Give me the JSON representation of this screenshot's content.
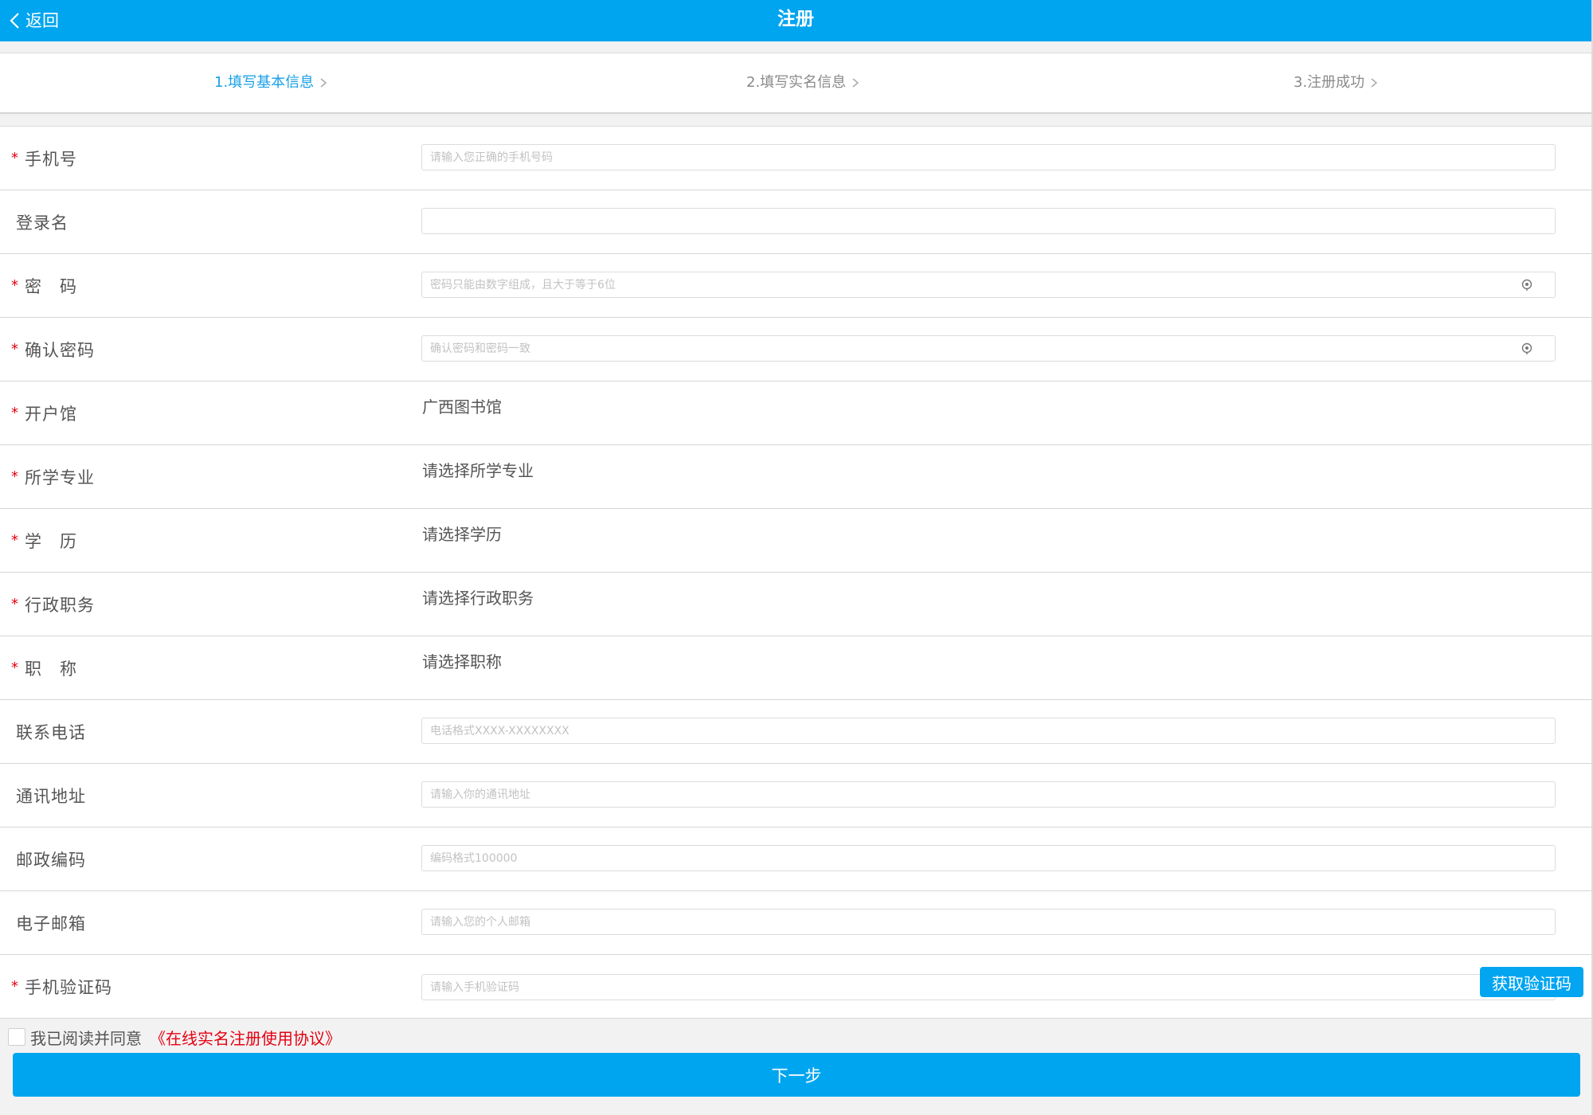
{
  "header": {
    "back_label": "返回",
    "title": "注册"
  },
  "steps": [
    {
      "label": "1.填写基本信息",
      "active": true
    },
    {
      "label": "2.填写实名信息",
      "active": false
    },
    {
      "label": "3.注册成功",
      "active": false
    }
  ],
  "form": {
    "phone": {
      "label": "手机号",
      "placeholder": "请输入您正确的手机号码"
    },
    "login_name": {
      "label": "登录名",
      "placeholder": ""
    },
    "password": {
      "label": "密　码",
      "placeholder": "密码只能由数字组成，且大于等于6位"
    },
    "confirm_password": {
      "label": "确认密码",
      "placeholder": "确认密码和密码一致"
    },
    "library": {
      "label": "开户馆",
      "value": "广西图书馆"
    },
    "major": {
      "label": "所学专业",
      "value": "请选择所学专业"
    },
    "education": {
      "label": "学　历",
      "value": "请选择学历"
    },
    "position": {
      "label": "行政职务",
      "value": "请选择行政职务"
    },
    "title": {
      "label": "职　称",
      "value": "请选择职称"
    },
    "contact_phone": {
      "label": "联系电话",
      "placeholder": "电话格式XXXX-XXXXXXXX"
    },
    "address": {
      "label": "通讯地址",
      "placeholder": "请输入你的通讯地址"
    },
    "postcode": {
      "label": "邮政编码",
      "placeholder": "编码格式100000"
    },
    "email": {
      "label": "电子邮箱",
      "placeholder": "请输入您的个人邮箱"
    },
    "sms_code": {
      "label": "手机验证码",
      "placeholder": "请输入手机验证码",
      "button_label": "获取验证码"
    }
  },
  "agreement": {
    "text": "我已阅读并同意",
    "link": "《在线实名注册使用协议》"
  },
  "next_button": "下一步",
  "colors": {
    "primary": "#00a5ef",
    "required": "#e60012",
    "active_step": "#1aa0e6"
  }
}
